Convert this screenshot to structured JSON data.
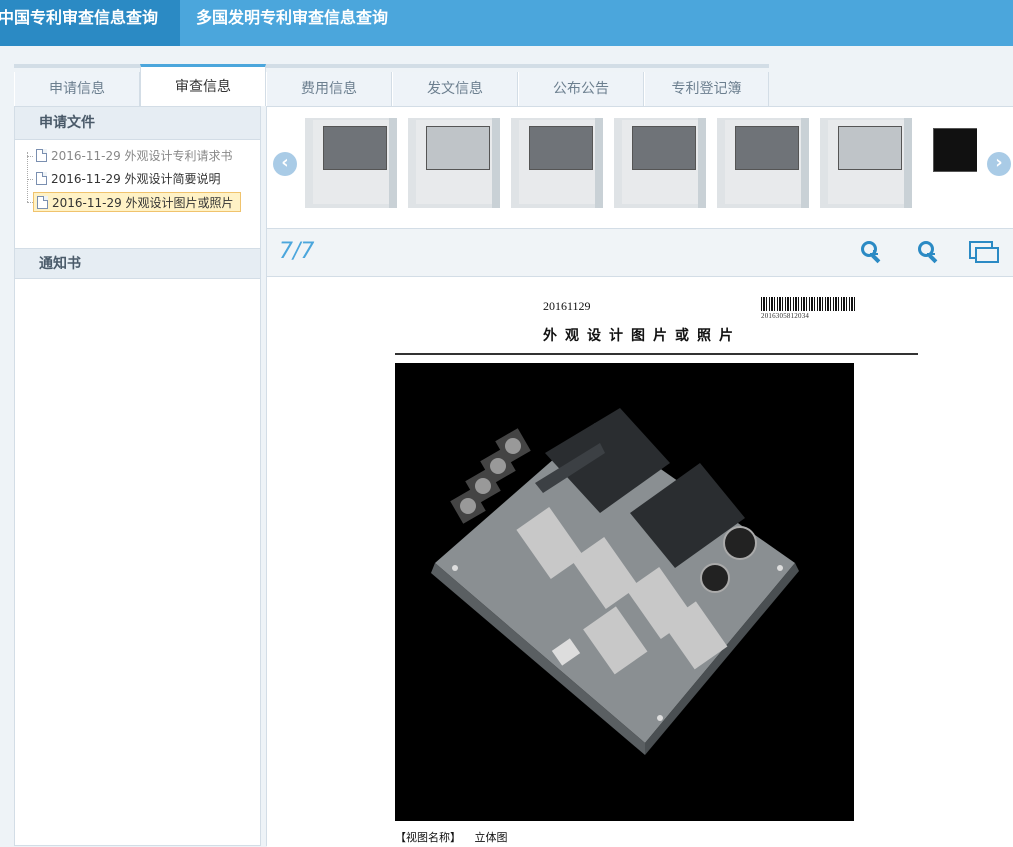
{
  "topnav": {
    "china": "中国专利审查信息查询",
    "multi": "多国发明专利审查信息查询"
  },
  "tabs": [
    "申请信息",
    "审查信息",
    "费用信息",
    "发文信息",
    "公布公告",
    "专利登记簿"
  ],
  "active_tab": "审查信息",
  "sidebar": {
    "app_docs_title": "申请文件",
    "docs": [
      {
        "label": "2016-11-29 外观设计专利请求书",
        "state": "muted"
      },
      {
        "label": "2016-11-29 外观设计简要说明",
        "state": "normal"
      },
      {
        "label": "2016-11-29 外观设计图片或照片",
        "state": "selected"
      }
    ],
    "notice_title": "通知书"
  },
  "viewer": {
    "page_indicator": "7/7",
    "prev_icon": "chevron-left-icon",
    "next_icon": "chevron-right-icon",
    "zoom_in_icon": "zoom-in-icon",
    "zoom_out_icon": "zoom-out-icon",
    "fit_icon": "fit-window-icon",
    "thumbnail_count": 7
  },
  "document": {
    "date": "20161129",
    "barcode_number": "2016305812034",
    "title": "外观设计图片或照片",
    "view_label": "【视图名称】",
    "view_value": "立体图"
  },
  "colors": {
    "topnav_bg": "#4ba6dc",
    "topnav_active": "#2b8ac4",
    "accent": "#4ba6dc",
    "selected_bg": "#fff2c6"
  }
}
